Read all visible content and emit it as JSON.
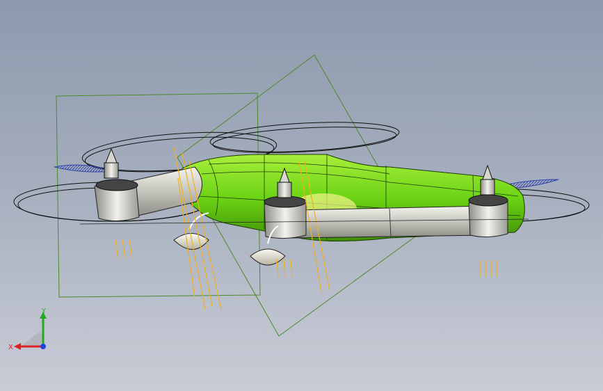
{
  "viewport": {
    "background_top": "#8c99ad",
    "background_bottom": "#c9ccd6"
  },
  "model": {
    "body_color": "#66cc11",
    "motor_color": "#d8d8d0",
    "sketch_color": "#4a8a2a",
    "propeller_color": "#3344aa",
    "wire_color": "#f0b020"
  },
  "triad": {
    "x_label": "X",
    "y_label": "Y",
    "x_color": "#dd2222",
    "y_color": "#22aa22",
    "z_color": "#2244dd"
  }
}
